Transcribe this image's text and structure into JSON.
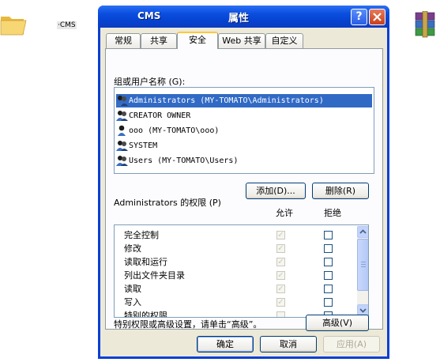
{
  "desktop": {
    "icon_label": "·CMS"
  },
  "window": {
    "title_name": "CMS",
    "title_props": "属性",
    "help_glyph": "?",
    "close_glyph": "✕"
  },
  "tabs": [
    {
      "label": "常规"
    },
    {
      "label": "共享"
    },
    {
      "label": "安全"
    },
    {
      "label": "Web 共享"
    },
    {
      "label": "自定义"
    }
  ],
  "active_tab": "安全",
  "security": {
    "group_label": "组或用户名称 (G):",
    "users": [
      {
        "name": "Administrators (MY-TOMATO\\Administrators)",
        "selected": true
      },
      {
        "name": "CREATOR OWNER",
        "selected": false
      },
      {
        "name": "ooo (MY-TOMATO\\ooo)",
        "selected": false
      },
      {
        "name": "SYSTEM",
        "selected": false
      },
      {
        "name": "Users (MY-TOMATO\\Users)",
        "selected": false
      }
    ],
    "add_button": "添加(D)...",
    "remove_button": "删除(R)",
    "perm_label": "Administrators 的权限 (P)",
    "allow_header": "允许",
    "deny_header": "拒绝",
    "permissions": [
      {
        "name": "完全控制",
        "allow": true,
        "deny": false
      },
      {
        "name": "修改",
        "allow": true,
        "deny": false
      },
      {
        "name": "读取和运行",
        "allow": true,
        "deny": false
      },
      {
        "name": "列出文件夹目录",
        "allow": true,
        "deny": false
      },
      {
        "name": "读取",
        "allow": true,
        "deny": false
      },
      {
        "name": "写入",
        "allow": true,
        "deny": false
      },
      {
        "name": "特别的权限",
        "allow": false,
        "deny": false
      }
    ],
    "advanced_hint": "特别权限或高级设置，请单击“高级”。",
    "advanced_button": "高级(V)"
  },
  "footer": {
    "ok": "确定",
    "cancel": "取消",
    "apply": "应用(A)"
  }
}
